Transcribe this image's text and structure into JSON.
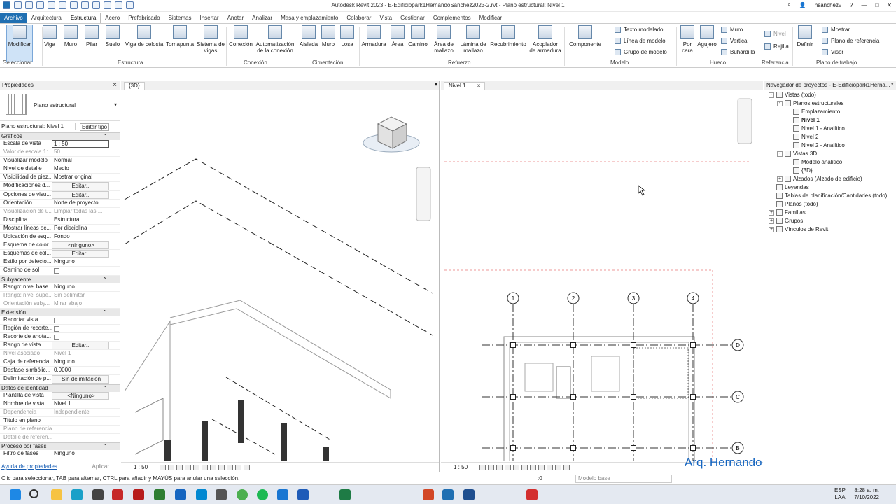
{
  "window": {
    "title": "Autodesk Revit 2023 - E-Edificiopark1HernandoSanchez2023-2.rvt - Plano estructural: Nivel 1",
    "user": "hsanchezv"
  },
  "tabs": [
    "Archivo",
    "Arquitectura",
    "Estructura",
    "Acero",
    "Prefabricado",
    "Sistemas",
    "Insertar",
    "Anotar",
    "Analizar",
    "Masa y emplazamiento",
    "Colaborar",
    "Vista",
    "Gestionar",
    "Complementos",
    "Modificar"
  ],
  "ribbon": {
    "modificar": "Modificar",
    "seleccionar": "Seleccionar",
    "viga": "Viga",
    "muro": "Muro",
    "pilar": "Pilar",
    "suelo": "Suelo",
    "celosia": "Viga de celosía",
    "tornapunta": "Tornapunta",
    "sistema_vigas": "Sistema de vigas",
    "conexion": "Conexión",
    "automatizacion": "Automatización de la conexión",
    "aislada": "Aislada",
    "muro2": "Muro",
    "losa": "Losa",
    "armadura": "Armadura",
    "area": "Área",
    "camino": "Camino",
    "area_mallazo": "Área de mallazo",
    "lamina_mallazo": "Lámina de mallazo",
    "recubrimiento": "Recubrimiento",
    "acoplador": "Acoplador de armadura",
    "componente": "Componente",
    "texto_modelado": "Texto modelado",
    "linea_modelo": "Línea de modelo",
    "grupo_modelo": "Grupo de modelo",
    "por_cara": "Por cara",
    "agujero": "Agujero",
    "hueco_muro": "Muro",
    "hueco_vertical": "Vertical",
    "buhardilla": "Buhardilla",
    "nivel": "Nivel",
    "rejilla": "Rejilla",
    "definir": "Definir",
    "mostrar": "Mostrar",
    "plano_ref": "Plano de referencia",
    "visor": "Visor",
    "groups": {
      "estructura": "Estructura",
      "conexion": "Conexión",
      "cimentacion": "Cimentación",
      "refuerzo": "Refuerzo",
      "modelo": "Modelo",
      "hueco": "Hueco",
      "referencia": "Referencia",
      "plano_trabajo": "Plano de trabajo"
    }
  },
  "properties": {
    "title": "Propiedades",
    "type_name": "Plano estructural",
    "selector": "Plano estructural: Nivel 1",
    "edit_type": "Editar tipo",
    "groups": [
      {
        "name": "Gráficos",
        "rows": [
          [
            "Escala de vista",
            "1 : 50",
            "input"
          ],
          [
            "Valor de escala    1:",
            "50",
            "dis"
          ],
          [
            "Visualizar modelo",
            "Normal",
            ""
          ],
          [
            "Nivel de detalle",
            "Medio",
            ""
          ],
          [
            "Visibilidad de piez...",
            "Mostrar original",
            ""
          ],
          [
            "Modificaciones d...",
            "Editar...",
            "btn"
          ],
          [
            "Opciones de visu...",
            "Editar...",
            "btn"
          ],
          [
            "Orientación",
            "Norte de proyecto",
            ""
          ],
          [
            "Visualización de u...",
            "Limpiar todas las ...",
            "dis"
          ],
          [
            "Disciplina",
            "Estructura",
            ""
          ],
          [
            "Mostrar líneas oc...",
            "Por disciplina",
            ""
          ],
          [
            "Ubicación de esq...",
            "Fondo",
            ""
          ],
          [
            "Esquema de color",
            "<ninguno>",
            "btn"
          ],
          [
            "Esquemas de col...",
            "Editar...",
            "btn"
          ],
          [
            "Estilo por defecto...",
            "Ninguno",
            ""
          ],
          [
            "Camino de sol",
            "",
            "chk"
          ]
        ]
      },
      {
        "name": "Subyacente",
        "rows": [
          [
            "Rango: nivel base",
            "Ninguno",
            ""
          ],
          [
            "Rango: nivel supe...",
            "Sin delimitar",
            "dis"
          ],
          [
            "Orientación suby...",
            "Mirar abajo",
            "dis"
          ]
        ]
      },
      {
        "name": "Extensión",
        "rows": [
          [
            "Recortar vista",
            "",
            "chk"
          ],
          [
            "Región de recorte...",
            "",
            "chk"
          ],
          [
            "Recorte de anota...",
            "",
            "chk"
          ],
          [
            "Rango de vista",
            "Editar...",
            "btn"
          ],
          [
            "Nivel asociado",
            "Nivel 1",
            "dis"
          ],
          [
            "Caja de referencia",
            "Ninguno",
            ""
          ],
          [
            "Desfase simbólic...",
            "0.0000",
            ""
          ],
          [
            "Delimitación de p...",
            "Sin delimitación",
            "btn"
          ]
        ]
      },
      {
        "name": "Datos de identidad",
        "rows": [
          [
            "Plantilla de vista",
            "<Ninguno>",
            "btn"
          ],
          [
            "Nombre de vista",
            "Nivel 1",
            ""
          ],
          [
            "Dependencia",
            "Independiente",
            "dis"
          ],
          [
            "Título en plano",
            "",
            ""
          ],
          [
            "Plano de referencia",
            "",
            "dis"
          ],
          [
            "Detalle de referen...",
            "",
            "dis"
          ]
        ]
      },
      {
        "name": "Proceso por fases",
        "rows": [
          [
            "Filtro de fases",
            "Ninguno",
            ""
          ]
        ]
      }
    ],
    "help": "Ayuda de propiedades",
    "apply": "Aplicar"
  },
  "views": {
    "view3d": "{3D}",
    "nivel1": "Nivel 1",
    "scale": "1 : 50"
  },
  "grid": {
    "cols": [
      "1",
      "2",
      "3",
      "4"
    ],
    "rows": [
      "D",
      "C",
      "B"
    ]
  },
  "browser": {
    "title": "Navegador de proyectos - E-Edificiopark1Herna...",
    "nodes": [
      [
        "Vistas (todo)",
        0,
        "-"
      ],
      [
        "Planos estructurales",
        1,
        "-"
      ],
      [
        "Emplazamiento",
        2,
        ""
      ],
      [
        "Nivel 1",
        2,
        "",
        true
      ],
      [
        "Nivel 1 - Analítico",
        2,
        ""
      ],
      [
        "Nivel 2",
        2,
        ""
      ],
      [
        "Nivel 2 - Analítico",
        2,
        ""
      ],
      [
        "Vistas 3D",
        1,
        "-"
      ],
      [
        "Modelo analítico",
        2,
        ""
      ],
      [
        "{3D}",
        2,
        ""
      ],
      [
        "Alzados (Alzado de edificio)",
        1,
        "+"
      ],
      [
        "Leyendas",
        0,
        ""
      ],
      [
        "Tablas de planificación/Cantidades (todo)",
        0,
        ""
      ],
      [
        "Planos (todo)",
        0,
        ""
      ],
      [
        "Familias",
        0,
        "+"
      ],
      [
        "Grupos",
        0,
        "+"
      ],
      [
        "Vínculos de Revit",
        0,
        "+"
      ]
    ]
  },
  "status": {
    "message": "Clic para seleccionar, TAB para alternar, CTRL para añadir y MAYÚS para anular una selección.",
    "scale": ":0",
    "model_base": "Modelo base"
  },
  "taskbar": {
    "lang1": "ESP",
    "lang2": "LAA",
    "time": "8:28 a. m.",
    "date": "7/10/2022"
  },
  "watermark": "Arq. Hernando Sánchez V."
}
